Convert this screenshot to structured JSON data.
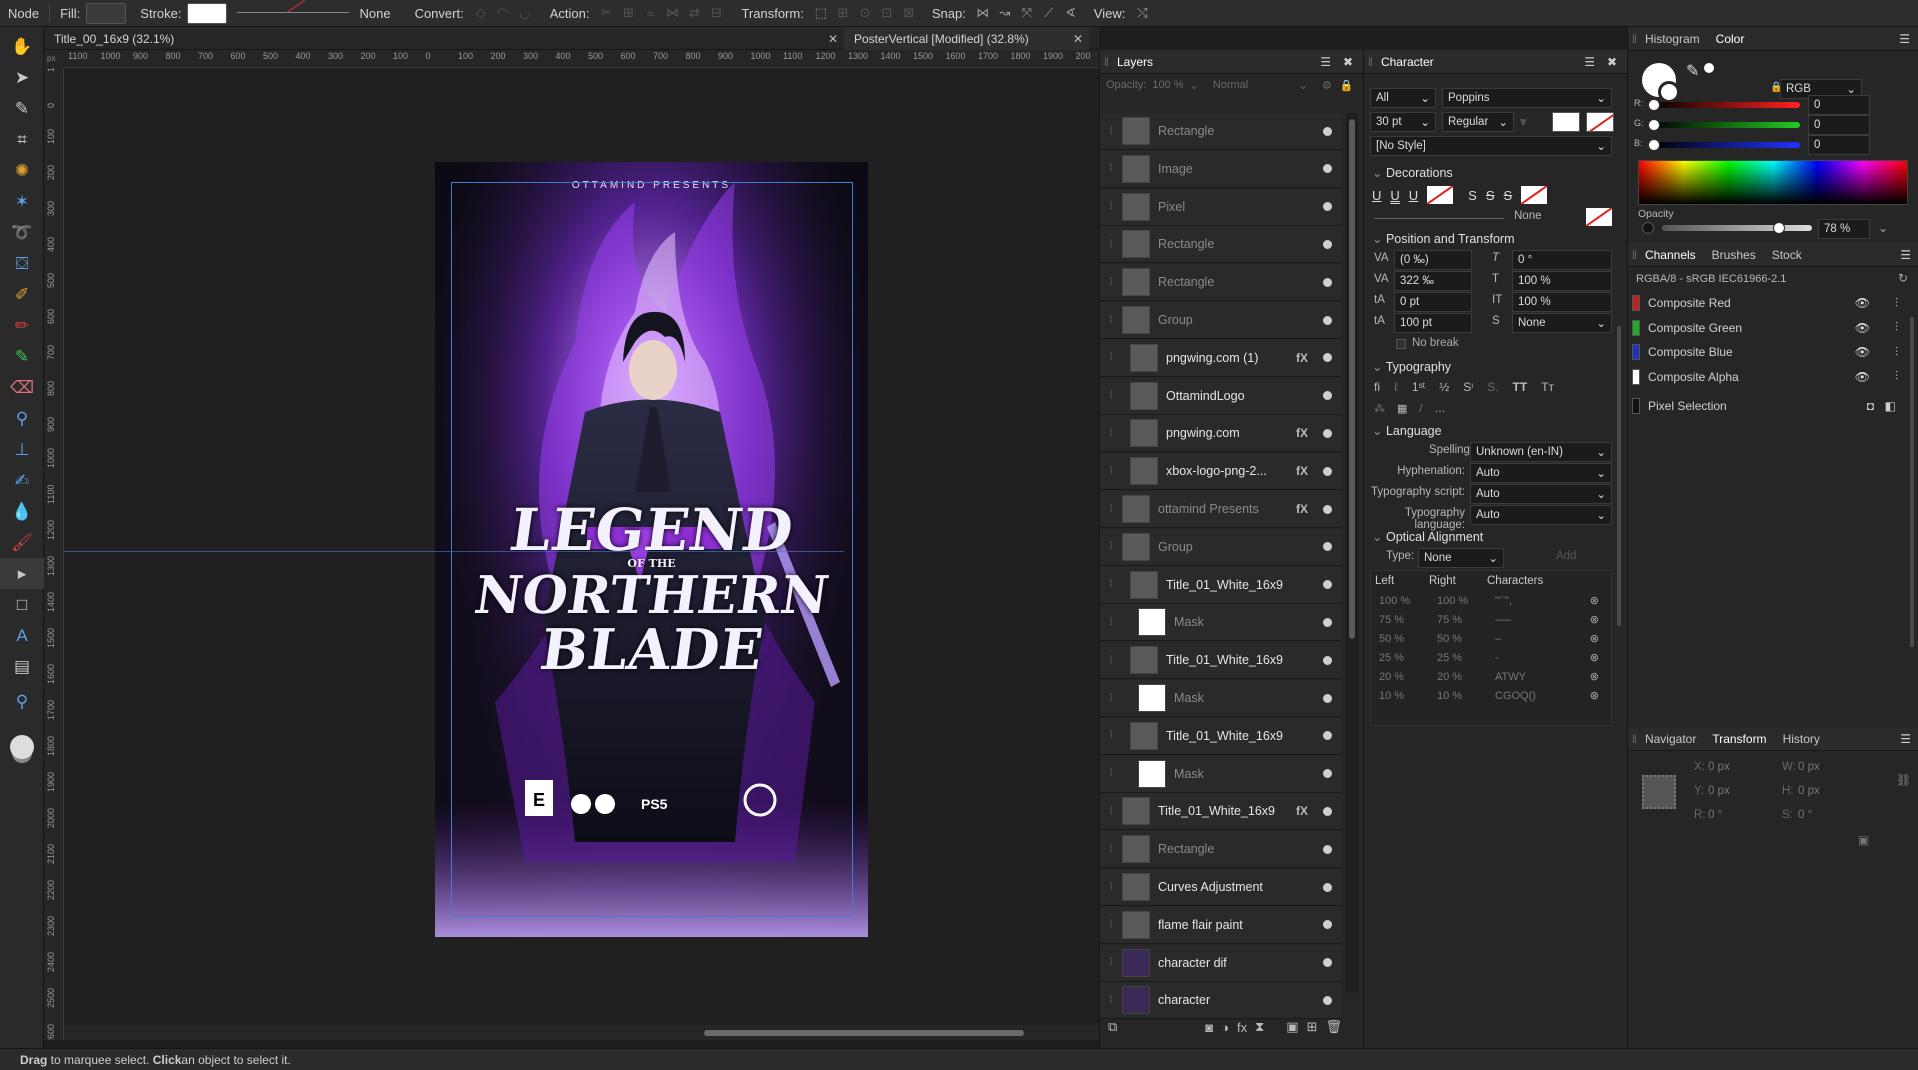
{
  "toolbar": {
    "node": "Node",
    "fill_label": "Fill:",
    "stroke_label": "Stroke:",
    "stroke_none": "None",
    "convert_label": "Convert:",
    "action_label": "Action:",
    "transform_label": "Transform:",
    "snap_label": "Snap:",
    "view_label": "View:",
    "fill_color": "#3a3a3a",
    "stroke_color": "#ffffff"
  },
  "tools": [
    "hand-tool-icon",
    "move-tool-icon",
    "color-picker-icon",
    "crop-tool-icon",
    "paint-mixer-icon",
    "magic-wand-icon",
    "lasso-tool-icon",
    "fill-bucket-icon",
    "flood-select-icon",
    "paint-brush-icon",
    "pixel-brush-icon",
    "erase-brush-icon",
    "zoom-tool-icon",
    "stamp-tool-icon",
    "smudge-icon",
    "dodge-icon",
    "burn-icon",
    "node-tool-icon",
    "rectangle-tool-icon",
    "text-tool-icon",
    "frame-text-icon",
    "view-tool-icon",
    "color-wheel-icon"
  ],
  "doc_tabs": [
    {
      "title": "Title_00_16x9 (32.1%)"
    },
    {
      "title": "PosterVertical [Modified] (32.8%)"
    }
  ],
  "rulers": {
    "h_ticks": [
      "1100",
      "1000",
      "900",
      "800",
      "700",
      "600",
      "500",
      "400",
      "300",
      "200",
      "100",
      "0",
      "100",
      "200",
      "300",
      "400",
      "500",
      "600",
      "700",
      "800",
      "900",
      "1000",
      "1100",
      "1200",
      "1300",
      "1400",
      "1500",
      "1600",
      "1700",
      "1800",
      "1900",
      "200"
    ],
    "v_ticks": [
      "100",
      "0",
      "100",
      "200",
      "300",
      "400",
      "500",
      "600",
      "700",
      "800",
      "900",
      "1000",
      "1100",
      "1200",
      "1300",
      "1400",
      "1500",
      "1600",
      "1700",
      "1800",
      "1900",
      "2000",
      "2100",
      "2200",
      "2300",
      "2400",
      "2500",
      "2600"
    ]
  },
  "poster": {
    "presents": "OTTAMIND PRESENTS",
    "title_line1": "LEGEND",
    "title_of": "OF THE",
    "title_line2": "NORTHERN",
    "title_line3": "BLADE",
    "rating": "E",
    "platform": "PS5"
  },
  "layers_panel": {
    "title": "Layers",
    "opacity_label": "Opacity:",
    "opacity_value": "100 %",
    "blend_mode": "Normal",
    "layers": [
      {
        "name": "Rectangle",
        "fx": false,
        "dim": true
      },
      {
        "name": "Image",
        "fx": false,
        "dim": true
      },
      {
        "name": "Pixel",
        "fx": false,
        "dim": true
      },
      {
        "name": "Rectangle",
        "fx": false,
        "dim": true
      },
      {
        "name": "Rectangle",
        "fx": false,
        "dim": true
      },
      {
        "name": "Group",
        "fx": false,
        "dim": true
      },
      {
        "name": "pngwing.com (1)",
        "fx": true,
        "dim": false
      },
      {
        "name": "OttamindLogo",
        "fx": false,
        "dim": false
      },
      {
        "name": "pngwing.com",
        "fx": true,
        "dim": false
      },
      {
        "name": "xbox-logo-png-2...",
        "fx": true,
        "dim": false
      },
      {
        "name": "ottamind Presents",
        "fx": true,
        "dim": true
      },
      {
        "name": "Group",
        "fx": false,
        "dim": true
      },
      {
        "name": "Title_01_White_16x9",
        "fx": false,
        "dim": false
      },
      {
        "name": "Mask",
        "fx": false,
        "dim": true
      },
      {
        "name": "Title_01_White_16x9",
        "fx": false,
        "dim": false
      },
      {
        "name": "Mask",
        "fx": false,
        "dim": true
      },
      {
        "name": "Title_01_White_16x9",
        "fx": false,
        "dim": false
      },
      {
        "name": "Mask",
        "fx": false,
        "dim": true
      },
      {
        "name": "Title_01_White_16x9",
        "fx": true,
        "dim": false
      },
      {
        "name": "Rectangle",
        "fx": false,
        "dim": true
      },
      {
        "name": "Curves Adjustment",
        "fx": false,
        "dim": false
      },
      {
        "name": "flame flair paint",
        "fx": false,
        "dim": false
      },
      {
        "name": "character dif",
        "fx": false,
        "dim": false
      },
      {
        "name": "character",
        "fx": false,
        "dim": false
      }
    ]
  },
  "character_panel": {
    "title": "Character",
    "scope": "All",
    "font": "Poppins",
    "size": "30 pt",
    "weight": "Regular",
    "style": "[No Style]",
    "decorations": "Decorations",
    "decor_none": "None",
    "pos_transform": "Position and Transform",
    "kerning": "(0 ‰)",
    "slant": "0 °",
    "tracking": "322 ‰",
    "hscale": "100 %",
    "baseline": "0 pt",
    "vscale": "100 %",
    "leading": "100 pt",
    "strike_none": "None",
    "no_break": "No break",
    "typography": "Typography",
    "language": "Language",
    "spelling_label": "Spelling:",
    "spelling": "Unknown (en-IN)",
    "hyphenation_label": "Hyphenation:",
    "hyphenation": "Auto",
    "script_label": "Typography script:",
    "script": "Auto",
    "lang_label": "Typography language:",
    "lang": "Auto",
    "optical": "Optical Alignment",
    "type_label": "Type:",
    "type_value": "None",
    "add": "Add",
    "col_left": "Left",
    "col_right": "Right",
    "col_chars": "Characters",
    "rows": [
      {
        "left": "100 %",
        "right": "100 %",
        "chars": "\"'`'',"
      },
      {
        "left": "75 %",
        "right": "75 %",
        "chars": "-‒–"
      },
      {
        "left": "50 %",
        "right": "50 %",
        "chars": "–"
      },
      {
        "left": "25 %",
        "right": "25 %",
        "chars": "-"
      },
      {
        "left": "20 %",
        "right": "20 %",
        "chars": "ATWY"
      },
      {
        "left": "10 %",
        "right": "10 %",
        "chars": "CGOQ()"
      }
    ]
  },
  "color_panel": {
    "tab_histogram": "Histogram",
    "tab_color": "Color",
    "model": "RGB",
    "r_label": "R:",
    "r": "0",
    "g_label": "G:",
    "g": "0",
    "b_label": "B:",
    "b": "0",
    "opacity_label": "Opacity",
    "opacity": "78 %",
    "opacity_fraction": 0.78
  },
  "channels_panel": {
    "tab_channels": "Channels",
    "tab_brushes": "Brushes",
    "tab_stock": "Stock",
    "profile": "RGBA/8 - sRGB IEC61966-2.1",
    "channels": [
      {
        "name": "Composite Red",
        "color": "#b22"
      },
      {
        "name": "Composite Green",
        "color": "#2a2"
      },
      {
        "name": "Composite Blue",
        "color": "#23b"
      },
      {
        "name": "Composite Alpha",
        "color": "#fff"
      },
      {
        "name": "Pixel Selection",
        "color": "#111"
      }
    ]
  },
  "transform_panel": {
    "tab_navigator": "Navigator",
    "tab_transform": "Transform",
    "tab_history": "History",
    "x_label": "X:",
    "x": "0 px",
    "y_label": "Y:",
    "y": "0 px",
    "w_label": "W:",
    "w": "0 px",
    "h_label": "H:",
    "h": "0 px",
    "r_label": "R:",
    "r": "0 °",
    "s_label": "S:",
    "s": "0 °"
  },
  "status": {
    "bold1": "Drag",
    "text1": " to marquee select. ",
    "bold2": "Click",
    "text2": " an object to select it."
  }
}
